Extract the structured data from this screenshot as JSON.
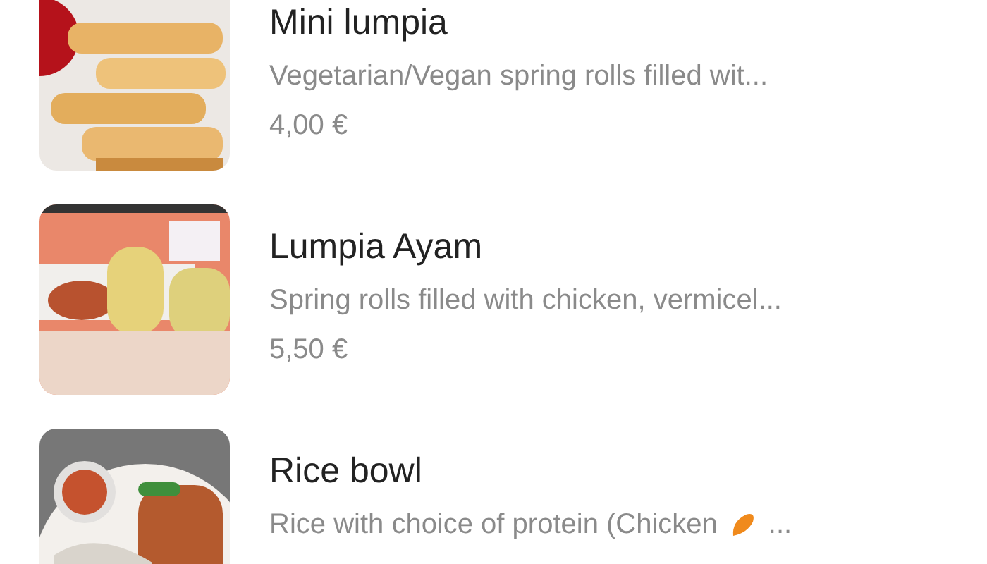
{
  "menu_items": [
    {
      "name": "Mini lumpia",
      "description": "Vegetarian/Vegan spring rolls filled wit...",
      "price": "4,00 €",
      "kind": "picture"
    },
    {
      "name": "Lumpia Ayam",
      "description": "Spring rolls filled with chicken, vermicel...",
      "price": "5,50 €",
      "kind": "picture"
    },
    {
      "name": "Rice bowl",
      "description": "Rice with choice of protein (Chicken",
      "description_icon": true,
      "description_end": "...",
      "kind": "picture"
    }
  ]
}
